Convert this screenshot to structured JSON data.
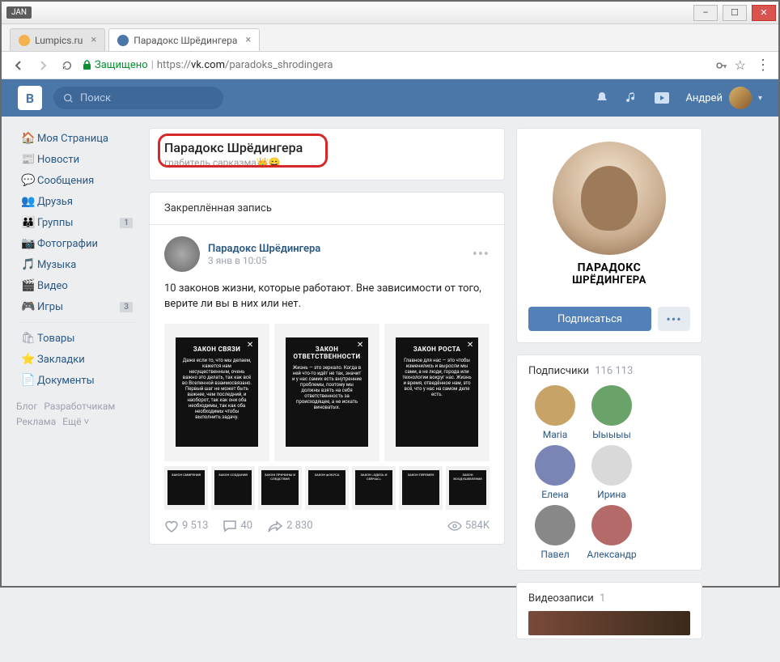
{
  "window": {
    "jan_badge": "JAN",
    "tabs": [
      {
        "label": "Lumpics.ru",
        "favicon": "#f3b24c"
      },
      {
        "label": "Парадокс Шрёдингера",
        "favicon": "#4a76a8"
      }
    ],
    "secure_label": "Защищено",
    "url_prefix": "https://",
    "url_host": "vk.com",
    "url_path": "/paradoks_shrodingera"
  },
  "vk_header": {
    "logo": "B",
    "search_placeholder": "Поиск",
    "username": "Андрей"
  },
  "left_nav": {
    "items": [
      {
        "icon": "🏠",
        "label": "Моя Страница"
      },
      {
        "icon": "📰",
        "label": "Новости"
      },
      {
        "icon": "💬",
        "label": "Сообщения"
      },
      {
        "icon": "👥",
        "label": "Друзья"
      },
      {
        "icon": "👪",
        "label": "Группы",
        "badge": "1"
      },
      {
        "icon": "📷",
        "label": "Фотографии"
      },
      {
        "icon": "🎵",
        "label": "Музыка"
      },
      {
        "icon": "🎬",
        "label": "Видео"
      },
      {
        "icon": "🎮",
        "label": "Игры",
        "badge": "3"
      }
    ],
    "items2": [
      {
        "icon": "🛍",
        "label": "Товары"
      },
      {
        "icon": "⭐",
        "label": "Закладки"
      },
      {
        "icon": "📄",
        "label": "Документы"
      }
    ],
    "footer": [
      "Блог",
      "Разработчикам",
      "Реклама",
      "Ещё ˅"
    ]
  },
  "group": {
    "title": "Парадокс Шрёдингера",
    "subtitle": "грабитель сарказма👑😄",
    "pinned_label": "Закреплённая запись",
    "post": {
      "author": "Парадокс Шрёдингера",
      "date": "3 янв в 10:05",
      "text": "10 законов жизни, которые работают. Вне зависимости от того, верите ли вы в них или нет.",
      "thumbs": [
        {
          "title": "ЗАКОН СВЯЗИ",
          "body": "Даже если то, что мы делаем, кажется нам несущественным, очень важно это делать, так как всё во Вселенной взаимосвязано. Первый шаг не может быть важнее, чем последний, и наоборот, так как они оба необходимы, так как оба необходимы чтобы выполнить задачу."
        },
        {
          "title": "ЗАКОН ОТВЕТСТВЕННОСТИ",
          "body": "Жизнь — это зеркало. Когда в ней что-то идёт не так, значит и у нас самих есть внутренние проблемы, поэтому мы должны взять на себя ответственность за происходящее, а не искать виноватых."
        },
        {
          "title": "ЗАКОН РОСТА",
          "body": "Главное для нас — это чтобы изменились и выросли мы сами, а не люди, города или технологии вокруг нас. Жизнь и время, отведённое нам, это всё, что у нас на самом деле есть."
        }
      ],
      "mini": [
        "ЗАКОН СМИРЕНИЯ",
        "ЗАКОН СОЗДАНИЯ",
        "ЗАКОН ПРИЧИНЫ И СЛЕДСТВИЯ",
        "ЗАКОН ФОКУСА",
        "ЗАКОН «ЗДЕСЬ И СЕЙЧАС»",
        "ЗАКОН ПЕРЕМЕН",
        "ЗАКОН ВООДУШЕВЛЕНИЯ"
      ],
      "likes": "9 513",
      "comments": "40",
      "shares": "2 830",
      "views": "584K"
    }
  },
  "right": {
    "logo_l1": "ПАРАДОКС",
    "logo_l2": "ШРЁДИНГЕРА",
    "subscribe_label": "Подписаться",
    "subscribers_label": "Подписчики",
    "subscribers_count": "116 113",
    "subs": [
      {
        "name": "Maria",
        "color": "#c7a368"
      },
      {
        "name": "Ыыыыы",
        "color": "#6aa36a"
      },
      {
        "name": "Елена",
        "color": "#7a84b5"
      },
      {
        "name": "Ирина",
        "color": "#d9d9d9"
      },
      {
        "name": "Павел",
        "color": "#888"
      },
      {
        "name": "Александр",
        "color": "#b56a6a"
      }
    ],
    "videos_label": "Видеозаписи",
    "videos_count": "1"
  }
}
